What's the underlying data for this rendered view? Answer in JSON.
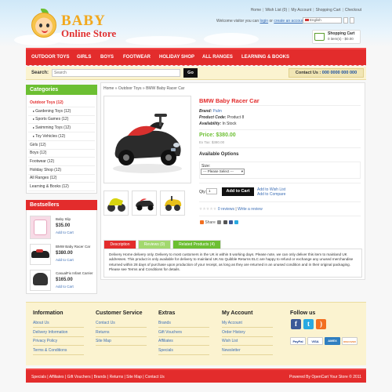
{
  "header": {
    "logo_baby": "BABY",
    "logo_sub": "Online Store",
    "top_links": [
      "Home",
      "Wish List (0)",
      "My Account",
      "Shopping Cart",
      "Checkout"
    ],
    "welcome_prefix": "Welcome visitor you can",
    "login": "login",
    "or": "or",
    "create_account": "create an account",
    "language": "English",
    "cart_title": "Shopping Cart",
    "cart_value": "0 item(s) - $0.00"
  },
  "nav": [
    "OUTDOOR TOYS",
    "GIRLS",
    "BOYS",
    "FOOTWEAR",
    "HOLIDAY SHOP",
    "ALL RANGES",
    "LEARNING & BOOKS"
  ],
  "search": {
    "label": "Search:",
    "placeholder": "Search",
    "go": "Go",
    "contact_label": "Contact Us :",
    "contact_number": "000 0000 000 000"
  },
  "categories": {
    "title": "Categories",
    "items": [
      {
        "label": "Outdoor Toys (12)",
        "active": true,
        "sub": false
      },
      {
        "label": "Gardening Toys (12)",
        "active": false,
        "sub": true
      },
      {
        "label": "Sports Games (12)",
        "active": false,
        "sub": true
      },
      {
        "label": "Swimming Toys (12)",
        "active": false,
        "sub": true
      },
      {
        "label": "Toy Vehicles (12)",
        "active": false,
        "sub": true
      },
      {
        "label": "Girls (12)",
        "active": false,
        "sub": false
      },
      {
        "label": "Boys (12)",
        "active": false,
        "sub": false
      },
      {
        "label": "Footwear (12)",
        "active": false,
        "sub": false
      },
      {
        "label": "Holiday Shop (12)",
        "active": false,
        "sub": false
      },
      {
        "label": "All Ranges (12)",
        "active": false,
        "sub": false
      },
      {
        "label": "Learning & Books (12)",
        "active": false,
        "sub": false
      }
    ]
  },
  "bestsellers": {
    "title": "Bestsellers",
    "items": [
      {
        "name": "Baby Slip",
        "price": "$35.00",
        "add": "Add to Cart"
      },
      {
        "name": "BMW Baby Racer Car",
        "price": "$380.00",
        "add": "Add to Cart"
      },
      {
        "name": "CasualFix Infant Carrier",
        "price": "$165.00",
        "add": "Add to Cart"
      }
    ]
  },
  "product": {
    "breadcrumb": "Home » Outdoor Toys » BMW Baby Racer Car",
    "title": "BMW Baby Racer Car",
    "brand_label": "Brand:",
    "brand": "Palm",
    "code_label": "Product Code:",
    "code": "Product 8",
    "availability_label": "Availability:",
    "availability": "In Stock",
    "price": "Price: $380.00",
    "ex_tax": "Ex Tax: $380.00",
    "options_title": "Available Options",
    "size_label": "Size:",
    "size_select": "--- Please Select ---",
    "qty_label": "Qty:",
    "qty_value": "1",
    "add_to_cart": "Add to Cart",
    "add_wishlist": "Add to Wish List",
    "add_compare": "Add to Compare",
    "reviews": "0 reviews",
    "write_review": "Write a review",
    "share": "Share",
    "rating": 0
  },
  "tabs": [
    "Description",
    "Reviews (0)",
    "Related Products (4)"
  ],
  "description": "Delivery Home delivery only. Delivery to most customers in the UK is within 5 working days. Please note, we can only deliver this item to mainland UK addresses. This product is only available for delivery to mainland UK.No Quibble Returns ELC are happy to refund or exchange any unused merchandise returned within 28 days of purchase upon production of your receipt, as long as they are returned in an unused condition and in their original packaging. Please see Terms and Conditions for details.",
  "footer": {
    "columns": [
      {
        "title": "Information",
        "links": [
          "About Us",
          "Delivery Information",
          "Privacy Policy",
          "Terms & Conditions"
        ]
      },
      {
        "title": "Customer Service",
        "links": [
          "Contact Us",
          "Returns",
          "Site Map"
        ]
      },
      {
        "title": "Extras",
        "links": [
          "Brands",
          "Gift Vouchers",
          "Affiliates",
          "Specials"
        ]
      },
      {
        "title": "My Account",
        "links": [
          "My Account",
          "Order History",
          "Wish List",
          "Newsletter"
        ]
      }
    ],
    "follow_title": "Follow us",
    "payments": [
      "PayPal",
      "VISA",
      "AMEX",
      "DISCOVER"
    ],
    "bottom_links": "Specials | Affiliates | Gift Vouchers | Brands | Returns | Site Map | Contact Us",
    "powered": "Powered By OpenCart Your Store © 2011"
  },
  "colors": {
    "brand_red": "#e32c2c",
    "brand_green": "#6cbf32",
    "cream": "#fbf3d0"
  }
}
